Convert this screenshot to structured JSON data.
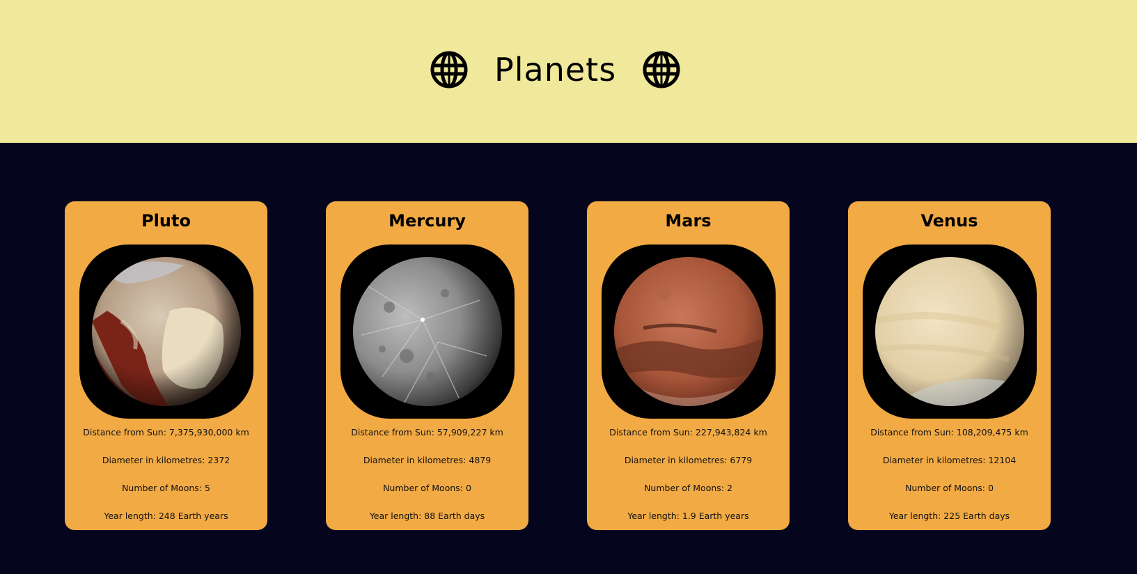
{
  "header": {
    "title": "Planets",
    "icon": "globe-icon"
  },
  "colors": {
    "header_bg": "#f0e99b",
    "page_bg": "#05061e",
    "card_bg": "#f2aa44"
  },
  "planets": [
    {
      "name": "Pluto",
      "distance": "Distance from Sun: 7,375,930,000 km",
      "diameter": "Diameter in kilometres: 2372",
      "moons": "Number of Moons: 5",
      "year": "Year length: 248 Earth years"
    },
    {
      "name": "Mercury",
      "distance": "Distance from Sun: 57,909,227 km",
      "diameter": "Diameter in kilometres: 4879",
      "moons": "Number of Moons: 0",
      "year": "Year length: 88 Earth days"
    },
    {
      "name": "Mars",
      "distance": "Distance from Sun: 227,943,824 km",
      "diameter": "Diameter in kilometres: 6779",
      "moons": "Number of Moons: 2",
      "year": "Year length: 1.9 Earth years"
    },
    {
      "name": "Venus",
      "distance": "Distance from Sun: 108,209,475 km",
      "diameter": "Diameter in kilometres: 12104",
      "moons": "Number of Moons: 0",
      "year": "Year length: 225 Earth days"
    }
  ]
}
